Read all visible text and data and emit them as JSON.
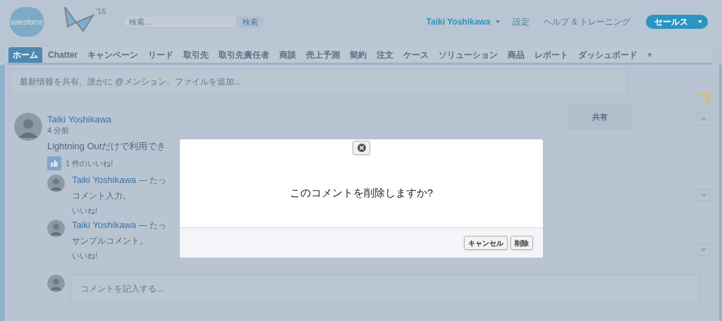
{
  "header": {
    "logo_text": "salesforce",
    "release_mark": "'16",
    "search": {
      "placeholder": "検索...",
      "button": "検索"
    },
    "user_menu": "Taiki Yoshikawa",
    "links": [
      "設定",
      "ヘルプ & トレーニング"
    ],
    "app_menu": "セールス"
  },
  "tabs": [
    {
      "label": "ホーム",
      "selected": true
    },
    {
      "label": "Chatter",
      "selected": false
    },
    {
      "label": "キャンペーン",
      "selected": false
    },
    {
      "label": "リード",
      "selected": false
    },
    {
      "label": "取引先",
      "selected": false
    },
    {
      "label": "取引先責任者",
      "selected": false
    },
    {
      "label": "商談",
      "selected": false
    },
    {
      "label": "売上予測",
      "selected": false
    },
    {
      "label": "契約",
      "selected": false
    },
    {
      "label": "注文",
      "selected": false
    },
    {
      "label": "ケース",
      "selected": false
    },
    {
      "label": "ソリューション",
      "selected": false
    },
    {
      "label": "商品",
      "selected": false
    },
    {
      "label": "レポート",
      "selected": false
    },
    {
      "label": "ダッシュボード",
      "selected": false
    },
    {
      "label": "+",
      "selected": false
    }
  ],
  "publisher": {
    "placeholder": "最新情報を共有、誰かに @メンション、ファイルを追加...",
    "share_button": "共有"
  },
  "post": {
    "author": "Taiki Yoshikawa",
    "time": "4 分前",
    "body": "Lightning Outだけで利用でき",
    "likes": "1 件のいいね!",
    "comments": [
      {
        "author": "Taiki Yoshikawa",
        "meta": "— たっ",
        "text": "コメント入力。",
        "like": "いいね!"
      },
      {
        "author": "Taiki Yoshikawa",
        "meta": "— たっ",
        "text": "サンプルコメント。",
        "like": "いいね!"
      }
    ],
    "comment_field": {
      "placeholder": "コメントを記入する..."
    }
  },
  "dialog": {
    "message": "このコメントを削除しますか?",
    "buttons": [
      "キャンセル",
      "削除"
    ]
  }
}
